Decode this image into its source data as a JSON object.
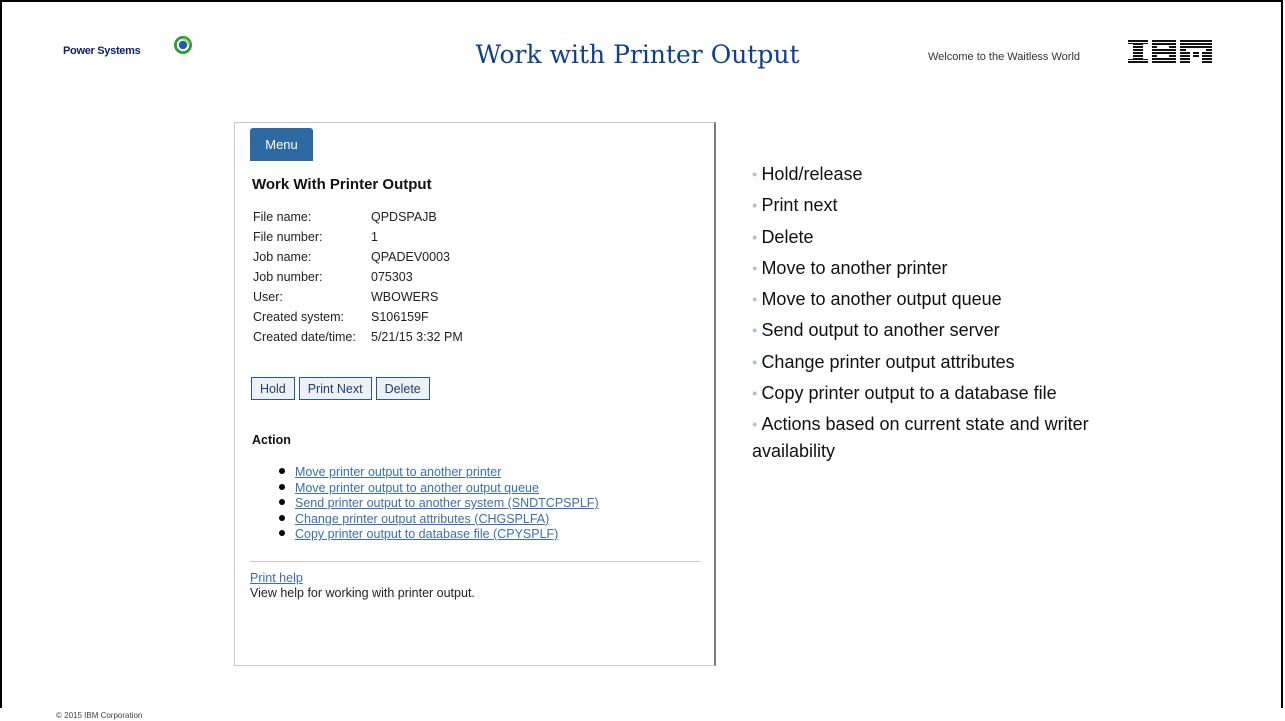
{
  "header": {
    "logo_text": "Power Systems",
    "title": "Work with Printer Output",
    "welcome": "Welcome to the Waitless World",
    "brand_logo": "IBM"
  },
  "panel": {
    "menu_label": "Menu",
    "heading": "Work With Printer Output",
    "info": [
      {
        "label": "File name:",
        "value": "QPDSPAJB"
      },
      {
        "label": "File number:",
        "value": "1"
      },
      {
        "label": "Job name:",
        "value": "QPADEV0003"
      },
      {
        "label": "Job number:",
        "value": "075303"
      },
      {
        "label": "User:",
        "value": "WBOWERS"
      },
      {
        "label": "Created system:",
        "value": "S106159F"
      },
      {
        "label": "Created date/time:",
        "value": "5/21/15 3:32 PM"
      }
    ],
    "buttons": {
      "hold": "Hold",
      "print_next": "Print Next",
      "delete": "Delete"
    },
    "action_heading": "Action",
    "actions": [
      "Move printer output to another printer",
      "Move printer output to another output queue",
      "Send printer output to another system (SNDTCPSPLF)",
      "Change printer output attributes (CHGSPLFA)",
      "Copy printer output to database file (CPYSPLF)"
    ],
    "help_link": "Print help",
    "help_desc": "View help for working with printer output."
  },
  "bullets": [
    "Hold/release",
    "Print next",
    "Delete",
    "Move to another printer",
    "Move to another output queue",
    "Send output to another server",
    "Change printer output attributes",
    "Copy printer output to a database file",
    "Actions based on current state and writer availability"
  ],
  "footer": "© 2015 IBM Corporation",
  "colors": {
    "title": "#0f3f90",
    "menu": "#2d6aa3",
    "link": "#3b6fb0",
    "bullet_dot": "#9ec3e6"
  }
}
